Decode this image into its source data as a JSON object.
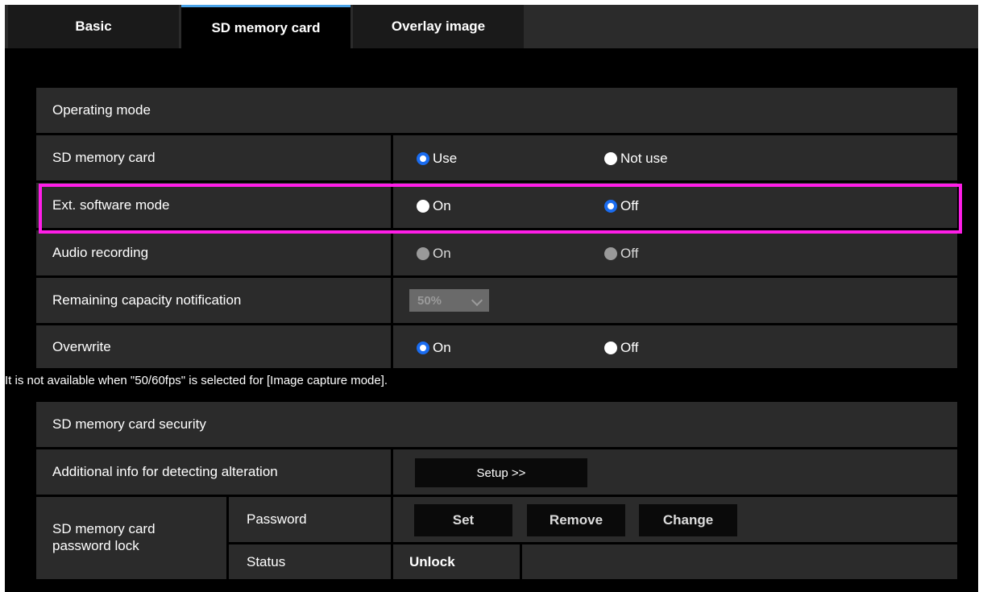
{
  "tabs": [
    {
      "label": "Basic",
      "active": false
    },
    {
      "label": "SD memory card",
      "active": true
    },
    {
      "label": "Overlay image",
      "active": false
    }
  ],
  "operating_mode": {
    "title": "Operating mode",
    "rows": [
      {
        "label": "SD memory card",
        "options": [
          "Use",
          "Not use"
        ],
        "selected": "Use"
      },
      {
        "label": "Ext. software mode",
        "options": [
          "On",
          "Off"
        ],
        "selected": "Off",
        "highlighted": true
      },
      {
        "label": "Audio recording",
        "options": [
          "On",
          "Off"
        ],
        "selected": null,
        "disabled": true
      },
      {
        "label": "Remaining capacity notification",
        "select_value": "50%",
        "disabled": true
      },
      {
        "label": "Overwrite",
        "options": [
          "On",
          "Off"
        ],
        "selected": "On"
      }
    ]
  },
  "note": "It is not available when \"50/60fps\" is selected for [Image capture mode].",
  "security": {
    "title": "SD memory card security",
    "alteration_label": "Additional info for detecting alteration",
    "setup_button": "Setup >>",
    "lock_label_line1": "SD memory card",
    "lock_label_line2": "password lock",
    "password_label": "Password",
    "set_button": "Set",
    "remove_button": "Remove",
    "change_button": "Change",
    "status_label": "Status",
    "status_value": "Unlock"
  },
  "colors": {
    "accent": "#1a6cf0",
    "highlight": "#ff1ee8",
    "tab_indicator": "#4aa3e8"
  }
}
